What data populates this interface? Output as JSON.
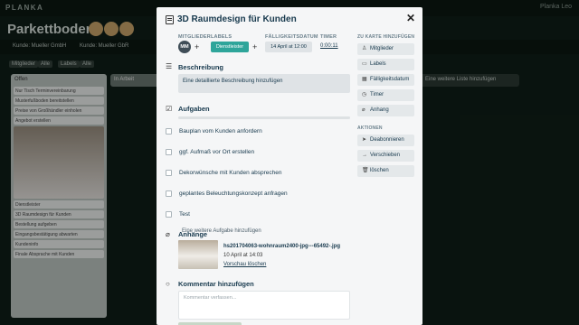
{
  "app": {
    "logo": "PLANKA",
    "user": "Planka Leo"
  },
  "board": {
    "title": "Parkettboden",
    "tabs": [
      "Kunde: Mueller GmbH",
      "Kunde: Mueller GbR"
    ],
    "filters": [
      "Mitglieder",
      "Alle",
      "Labels",
      "Alle"
    ],
    "lists": [
      {
        "title": "Offen",
        "cards": [
          "Nur Tisch Terminvereinbarung",
          "Musterfußboden bereitstellen",
          "Preise von Großhändler einholen",
          "Angebot erstellen"
        ]
      },
      {
        "title": "In Arbeit"
      }
    ],
    "image_card": {
      "label": "Dienstleister",
      "title": "3D Raumdesign für Kunden"
    },
    "more_cards": [
      "Bestellung aufgeben",
      "Eingangsbestätigung abwarten",
      "Kundeninfo",
      "Finale Absprache mit Kunden"
    ],
    "add_list": "Eine weitere Liste hinzufügen"
  },
  "modal": {
    "title": "3D Raumdesign für Kunden",
    "members_label": "MITGLIEDER",
    "member_initials": "MM",
    "labels_label": "LABELS",
    "label_name": "Dienstleister",
    "due_label": "FÄLLIGKEITSDATUM",
    "due_value": "14 April at 12:00",
    "timer_label": "TIMER",
    "timer_value": "0:00:11",
    "description_title": "Beschreibung",
    "description_placeholder": "Eine detaillierte Beschreibung hinzufügen",
    "tasks_title": "Aufgaben",
    "tasks_done_fraction": 0,
    "tasks": [
      "Bauplan vom Kunden anfordern",
      "ggf. Aufmaß vor Ort erstellen",
      "Dekorwünsche mit Kunden absprechen",
      "geplantes Beleuchtungskonzept anfragen",
      "Test"
    ],
    "add_task": "Eine weitere Aufgabe hinzufügen",
    "attachments_title": "Anhänge",
    "attachment_name": "hs201704063-wohnraum2400-jpg---65492-.jpg",
    "attachment_date": "10 April at 14:03",
    "attachment_action": "Vorschau löschen",
    "comment_title": "Kommentar hinzufügen",
    "comment_placeholder": "Kommentar verfassen...",
    "add_to_card_header": "ZU KARTE HINZUFÜGEN",
    "add_buttons": [
      "Mitglieder",
      "Labels",
      "Fälligkeitsdatum",
      "Timer",
      "Anhang"
    ],
    "actions_header": "AKTIONEN",
    "action_buttons": [
      "Deabonnieren",
      "Verschieben",
      "löschen"
    ]
  },
  "colors": {
    "label": "#2ea59a",
    "modal_bg": "#f5f6f7",
    "board_bg": "#0f1e17"
  }
}
